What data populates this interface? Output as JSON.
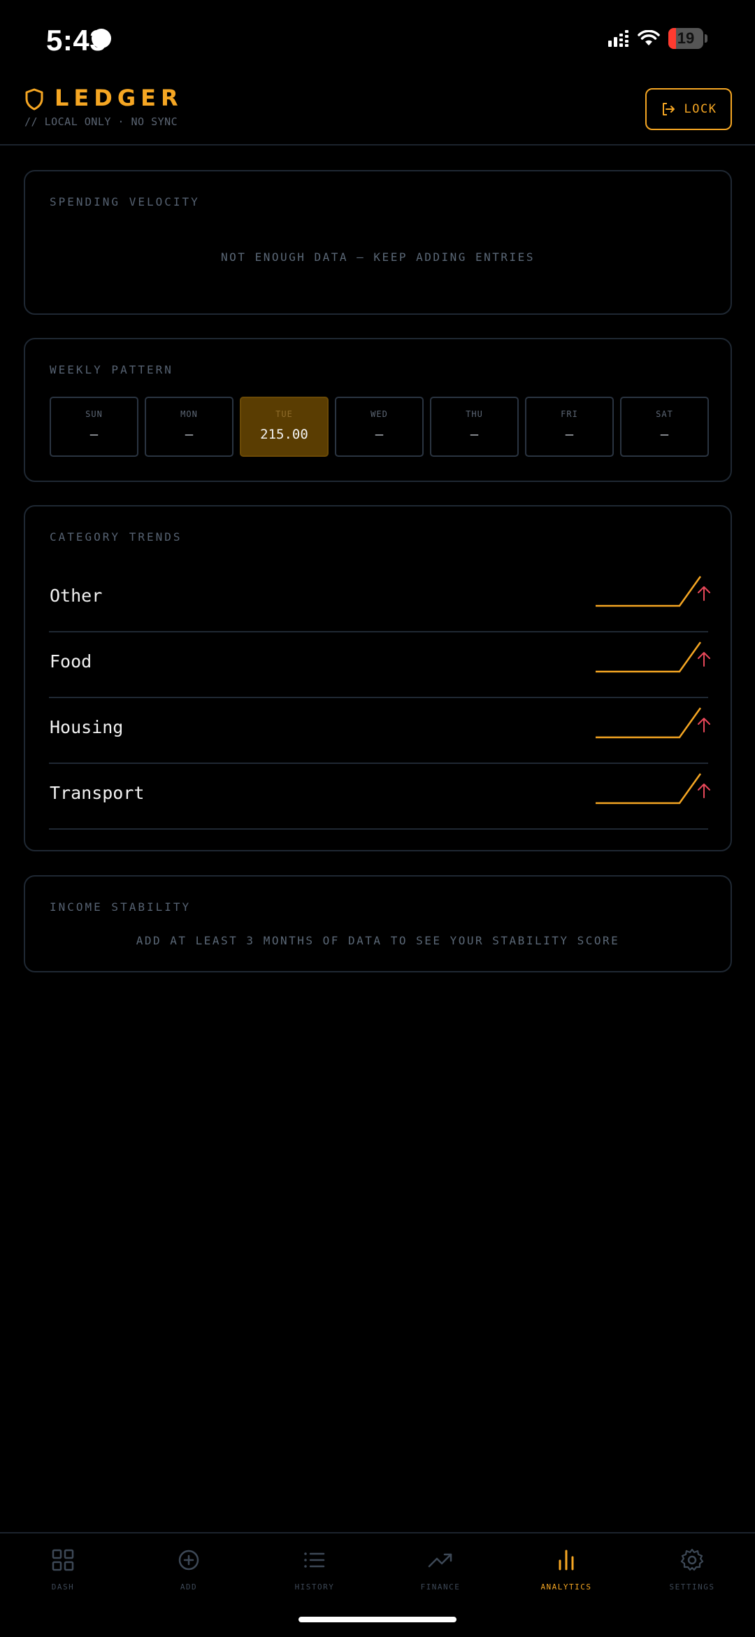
{
  "status_bar": {
    "time": "5:43",
    "battery": "19"
  },
  "header": {
    "brand": "LEDGER",
    "subtitle": "// LOCAL ONLY · NO SYNC",
    "lock_label": "LOCK"
  },
  "velocity": {
    "title": "SPENDING VELOCITY",
    "message": "NOT ENOUGH DATA — KEEP ADDING ENTRIES"
  },
  "weekly": {
    "title": "WEEKLY PATTERN",
    "days": [
      {
        "label": "SUN",
        "value": "—"
      },
      {
        "label": "MON",
        "value": "—"
      },
      {
        "label": "TUE",
        "value": "215.00"
      },
      {
        "label": "WED",
        "value": "—"
      },
      {
        "label": "THU",
        "value": "—"
      },
      {
        "label": "FRI",
        "value": "—"
      },
      {
        "label": "SAT",
        "value": "—"
      }
    ]
  },
  "trends": {
    "title": "CATEGORY TRENDS",
    "items": [
      {
        "name": "Other",
        "direction": "up"
      },
      {
        "name": "Food",
        "direction": "up"
      },
      {
        "name": "Housing",
        "direction": "up"
      },
      {
        "name": "Transport",
        "direction": "up"
      }
    ],
    "spark_color": "#f5a623",
    "arrow_color": "#e8485a"
  },
  "stability": {
    "title": "INCOME STABILITY",
    "message": "ADD AT LEAST 3 MONTHS OF DATA TO SEE YOUR STABILITY SCORE"
  },
  "nav": {
    "items": [
      {
        "label": "DASH",
        "icon": "grid-icon"
      },
      {
        "label": "ADD",
        "icon": "plus-circle-icon"
      },
      {
        "label": "HISTORY",
        "icon": "list-icon"
      },
      {
        "label": "FINANCE",
        "icon": "trending-up-icon"
      },
      {
        "label": "ANALYTICS",
        "icon": "bar-chart-icon"
      },
      {
        "label": "SETTINGS",
        "icon": "gear-icon"
      }
    ],
    "active": "ANALYTICS"
  },
  "colors": {
    "accent": "#f5a623",
    "background": "#000000",
    "border": "#1f2833"
  }
}
